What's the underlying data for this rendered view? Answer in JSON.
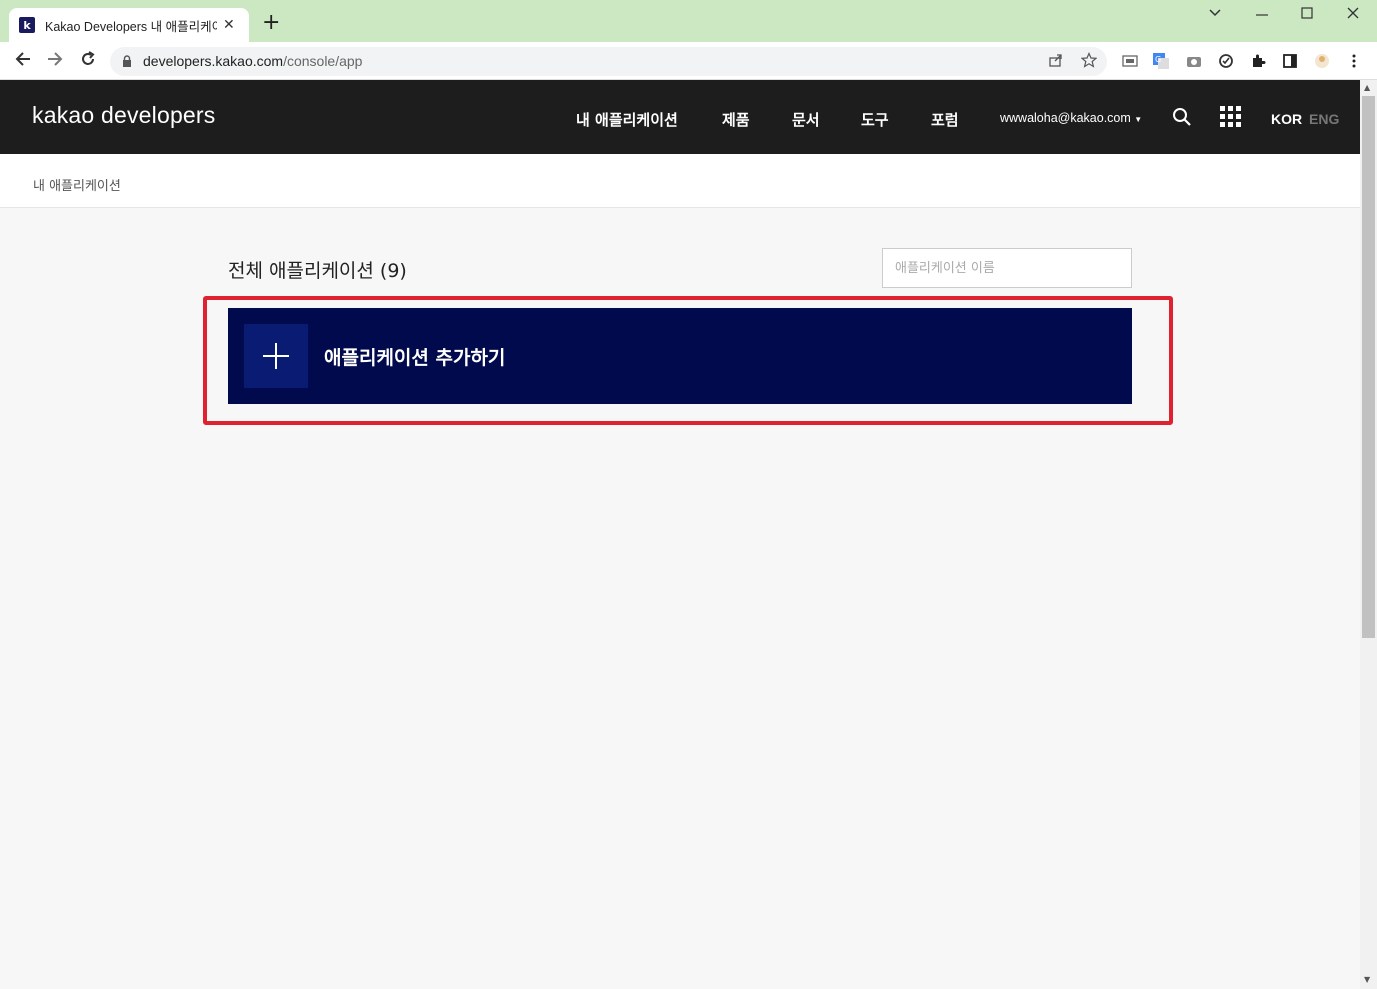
{
  "browser": {
    "tab_title": "Kakao Developers 내 애플리케이션",
    "favicon_letter": "k",
    "tab_close": "✕",
    "new_tab": "+",
    "url_domain": "developers.kakao.com",
    "url_path": "/console/app"
  },
  "header": {
    "logo": "kakao developers",
    "nav": [
      "내 애플리케이션",
      "제품",
      "문서",
      "도구",
      "포럼"
    ],
    "account": "wwwaloha@kakao.com",
    "lang_kor": "KOR",
    "lang_eng": "ENG"
  },
  "breadcrumb": "내 애플리케이션",
  "main": {
    "title": "전체 애플리케이션 (9)",
    "search_placeholder": "애플리케이션 이름",
    "add_label": "애플리케이션 추가하기"
  },
  "colors": {
    "header_bg": "#1d1d1d",
    "add_button_bg": "#000a4c",
    "plus_box_bg": "#0a1b73",
    "highlight": "#e0212f"
  }
}
